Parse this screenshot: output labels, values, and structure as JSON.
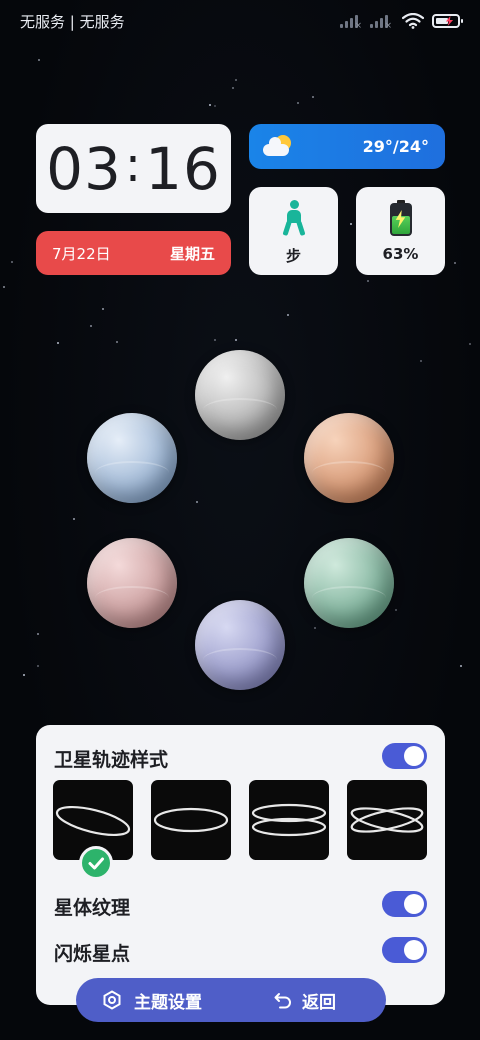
{
  "status_bar": {
    "carrier": "无服务 | 无服务",
    "icons": [
      "signal-no-service-icon",
      "signal-no-service-icon",
      "wifi-icon",
      "battery-charging-icon"
    ]
  },
  "clock": {
    "hour": "03",
    "separator": ":",
    "minute": "16"
  },
  "date": {
    "day": "7月22日",
    "weekday": "星期五",
    "color": "#e84a4a"
  },
  "weather": {
    "icon": "partly-cloudy-icon",
    "temperature": "29°/24°",
    "color": "#1a84e8"
  },
  "steps": {
    "icon": "walking-person-icon",
    "label": "步"
  },
  "battery": {
    "icon": "battery-charging-icon",
    "label": "63%",
    "level": 0.63
  },
  "planets": [
    {
      "name": "planet-gray",
      "colors": [
        "#f0f0f0",
        "#9a9a9a"
      ]
    },
    {
      "name": "planet-orange",
      "colors": [
        "#f7d3bb",
        "#c98058"
      ]
    },
    {
      "name": "planet-green",
      "colors": [
        "#cfe9dc",
        "#5f9c82"
      ]
    },
    {
      "name": "planet-purple",
      "colors": [
        "#d7d9f2",
        "#7d7fb8"
      ]
    },
    {
      "name": "planet-pink",
      "colors": [
        "#f4dada",
        "#b98585"
      ]
    },
    {
      "name": "planet-blue",
      "colors": [
        "#e6eef8",
        "#7f9fc6"
      ]
    }
  ],
  "settings": {
    "orbit_style_label": "卫星轨迹样式",
    "orbit_style_enabled": true,
    "orbit_options": [
      "single-tilted-orbit",
      "single-flat-orbit",
      "double-flat-orbit",
      "crossed-orbit"
    ],
    "selected_option": 0,
    "texture_label": "星体纹理",
    "texture_enabled": true,
    "twinkle_label": "闪烁星点",
    "twinkle_enabled": true,
    "accent": "#4a5bd6"
  },
  "bottom_bar": {
    "theme_settings_label": "主题设置",
    "theme_icon": "hexagon-settings-icon",
    "back_label": "返回",
    "back_icon": "undo-arrow-icon"
  }
}
